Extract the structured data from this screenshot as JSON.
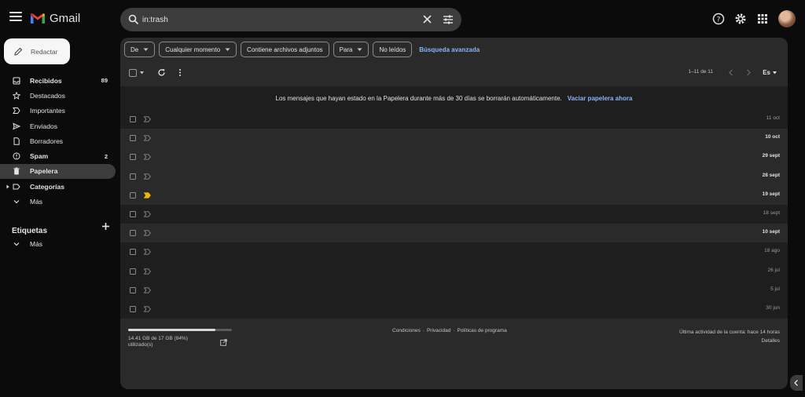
{
  "app": {
    "logo_text": "Gmail"
  },
  "search": {
    "query": "in:trash"
  },
  "compose": {
    "label": "Redactar"
  },
  "nav": {
    "items": [
      {
        "label": "Recibidos",
        "count": "89",
        "bold": true,
        "icon": "inbox-icon"
      },
      {
        "label": "Destacados",
        "count": "",
        "bold": false,
        "icon": "star-icon"
      },
      {
        "label": "Importantes",
        "count": "",
        "bold": false,
        "icon": "important-icon"
      },
      {
        "label": "Enviados",
        "count": "",
        "bold": false,
        "icon": "send-icon"
      },
      {
        "label": "Borradores",
        "count": "",
        "bold": false,
        "icon": "draft-icon"
      },
      {
        "label": "Spam",
        "count": "2",
        "bold": true,
        "icon": "spam-icon"
      },
      {
        "label": "Papelera",
        "count": "",
        "bold": true,
        "icon": "trash-icon",
        "active": true
      },
      {
        "label": "Categorías",
        "count": "",
        "bold": true,
        "icon": "label-icon",
        "caret": true
      },
      {
        "label": "Más",
        "count": "",
        "bold": false,
        "icon": "expand-icon"
      }
    ]
  },
  "labels": {
    "title": "Etiquetas",
    "more": "Más"
  },
  "filters": {
    "chips": [
      "De",
      "Cualquier momento",
      "Contiene archivos adjuntos",
      "Para",
      "No leídos"
    ],
    "chip_dropdowns": [
      true,
      true,
      false,
      true,
      false
    ],
    "advanced": "Búsqueda avanzada"
  },
  "toolbar": {
    "pager": "1–11 de 11",
    "lang": "Es"
  },
  "banner": {
    "text": "Los mensajes que hayan estado en la Papelera durante más de 30 días se borrarán automáticamente.",
    "link": "Vaciar papelera ahora"
  },
  "rows": [
    {
      "date": "11 oct",
      "unread": false,
      "important": false
    },
    {
      "date": "10 oct",
      "unread": true,
      "important": false
    },
    {
      "date": "29 sept",
      "unread": true,
      "important": false
    },
    {
      "date": "28 sept",
      "unread": true,
      "important": false
    },
    {
      "date": "19 sept",
      "unread": true,
      "important": true
    },
    {
      "date": "18 sept",
      "unread": false,
      "important": false
    },
    {
      "date": "10 sept",
      "unread": true,
      "important": false
    },
    {
      "date": "18 ago",
      "unread": false,
      "important": false
    },
    {
      "date": "26 jul",
      "unread": false,
      "important": false
    },
    {
      "date": "5 jul",
      "unread": false,
      "important": false
    },
    {
      "date": "30 jun",
      "unread": false,
      "important": false
    }
  ],
  "footer": {
    "storage_text": "14.41 GB de 17 GB (84%) utilizado(s)",
    "storage_fraction": 0.84,
    "links": [
      "Condiciones",
      "·",
      "Privacidad",
      "·",
      "Políticas de programa"
    ],
    "activity": "Última actividad de la cuenta: hace 14 horas",
    "details": "Detalles"
  },
  "colors": {
    "accent_link": "#8ab4f8",
    "important_marker": "#f2b600",
    "compose_bg": "#f6f6f6"
  }
}
